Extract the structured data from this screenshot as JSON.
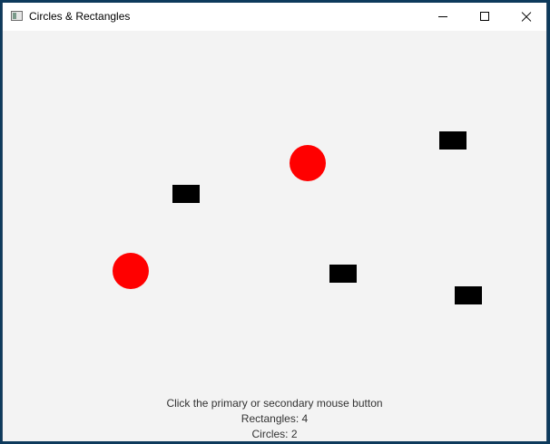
{
  "window": {
    "title": "Circles & Rectangles",
    "icon": "app-window-icon",
    "controls": [
      "minimize-icon",
      "maximize-icon",
      "close-icon"
    ]
  },
  "canvas": {
    "shapes": {
      "circles": [
        {
          "color": "#ff0000"
        },
        {
          "color": "#ff0000"
        }
      ],
      "rectangles": [
        {
          "color": "#000000"
        },
        {
          "color": "#000000"
        },
        {
          "color": "#000000"
        },
        {
          "color": "#000000"
        }
      ]
    }
  },
  "info": {
    "instruction": "Click the primary or secondary mouse button",
    "rectangles_text": "Rectangles: 4",
    "circles_text": "Circles: 2"
  },
  "colors": {
    "circle": "#ff0000",
    "rectangle": "#000000",
    "background": "#f3f3f3"
  }
}
